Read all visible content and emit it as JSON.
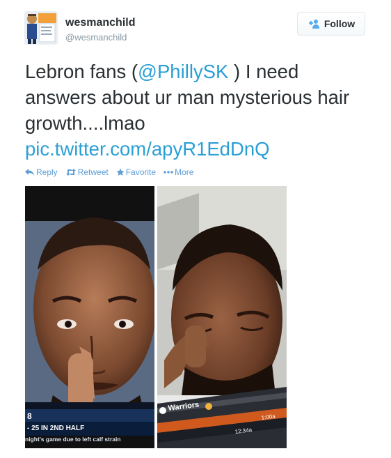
{
  "user": {
    "display_name": "wesmanchild",
    "handle": "@wesmanchild"
  },
  "follow_button": {
    "label": "Follow"
  },
  "tweet": {
    "text_part1": "Lebron fans (",
    "mention": "@PhillySK",
    "text_part2": " ) I need answers about ur man mysterious hair growth....lmao ",
    "link": "pic.twitter.com/apyR1EdDnQ"
  },
  "actions": [
    {
      "label": "Reply",
      "icon": "reply-icon"
    },
    {
      "label": "Retweet",
      "icon": "retweet-icon"
    },
    {
      "label": "Favorite",
      "icon": "star-icon"
    },
    {
      "label": "More",
      "icon": "more-dots-icon"
    }
  ],
  "media": {
    "left_photo": {
      "ticker_number": "8",
      "ticker_line1": "- 25 IN 2ND HALF",
      "ticker_line2": "night's game due to left calf strain"
    },
    "right_photo": {
      "scoreboard_team": "Warriors",
      "scoreboard_time1": "1:00a",
      "scoreboard_time2": "12:34a"
    }
  },
  "colors": {
    "link": "#2a9fd6",
    "action": "#5d9dd5",
    "handle": "#8899a6",
    "text": "#292f33"
  }
}
